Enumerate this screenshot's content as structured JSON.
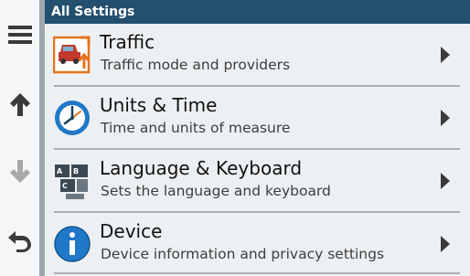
{
  "header": {
    "title": "All Settings"
  },
  "sidebar": {
    "items": [
      {
        "icon": "menu-icon"
      },
      {
        "icon": "arrow-up-icon"
      },
      {
        "icon": "arrow-down-icon",
        "enabled": false
      },
      {
        "icon": "back-icon"
      }
    ]
  },
  "settings": {
    "items": [
      {
        "title": "Traffic",
        "subtitle": "Traffic mode and providers",
        "icon": "traffic-icon"
      },
      {
        "title": "Units & Time",
        "subtitle": "Time and units of measure",
        "icon": "clock-icon"
      },
      {
        "title": "Language & Keyboard",
        "subtitle": "Sets the language and keyboard",
        "icon": "keyboard-icon",
        "key_labels": [
          "A",
          "B",
          "C"
        ]
      },
      {
        "title": "Device",
        "subtitle": "Device information and privacy settings",
        "icon": "info-icon"
      }
    ]
  },
  "colors": {
    "header_bg": "#24506f",
    "accent_blue": "#1f78c8",
    "traffic_orange": "#e5731c"
  }
}
